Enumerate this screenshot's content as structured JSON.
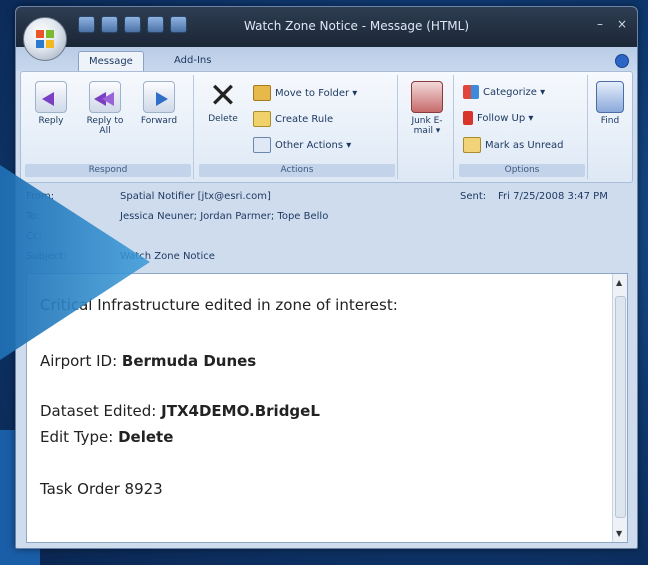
{
  "window": {
    "title": "Watch Zone Notice - Message (HTML)",
    "controls": {
      "minimize": "–",
      "close": "×"
    }
  },
  "tabs": [
    {
      "label": "Message",
      "active": true
    },
    {
      "label": "Add-Ins",
      "active": false
    }
  ],
  "ribbon": {
    "groups": {
      "respond": {
        "label": "Respond",
        "buttons": [
          {
            "label": "Reply",
            "icon": "reply-icon"
          },
          {
            "label": "Reply to All",
            "icon": "reply-all-icon"
          },
          {
            "label": "Forward",
            "icon": "forward-icon"
          }
        ]
      },
      "actions": {
        "label": "Actions",
        "delete_label": "Delete",
        "items": [
          {
            "label": "Move to Folder ▾",
            "icon": "move-folder-icon"
          },
          {
            "label": "Create Rule",
            "icon": "create-rule-icon"
          },
          {
            "label": "Other Actions ▾",
            "icon": "other-actions-icon"
          }
        ]
      },
      "send": {
        "label": "Junk E-mail ▾"
      },
      "options": {
        "label": "Options",
        "items": [
          {
            "label": "Categorize ▾",
            "icon": "categorize-icon"
          },
          {
            "label": "Follow Up ▾",
            "icon": "follow-up-flag-icon"
          },
          {
            "label": "Mark as Unread",
            "icon": "mark-unread-icon"
          }
        ]
      },
      "find": {
        "label": "Find"
      }
    }
  },
  "header": {
    "from_label": "From:",
    "from_value": "Spatial Notifier [jtx@esri.com]",
    "sent_label": "Sent:",
    "sent_value": "Fri 7/25/2008 3:47 PM",
    "to_label": "To:",
    "to_value": "Jessica Neuner; Jordan Parmer; Tope Bello",
    "cc_label": "Cc:",
    "subject_label": "Subject:",
    "subject_value": "Watch Zone Notice"
  },
  "message": {
    "line1": "Critical Infrastructure edited in zone of interest:",
    "airport_label": "Airport ID:",
    "airport_value": "Bermuda Dunes",
    "dataset_label": "Dataset Edited:",
    "dataset_value": "JTX4DEMO.BridgeL",
    "edit_label": "Edit Type:",
    "edit_value": "Delete",
    "task_order": "Task Order 8923"
  },
  "colors": {
    "background": "#0f3a72",
    "arrow": "#2a86c8",
    "titlebar": "#1b2636"
  }
}
